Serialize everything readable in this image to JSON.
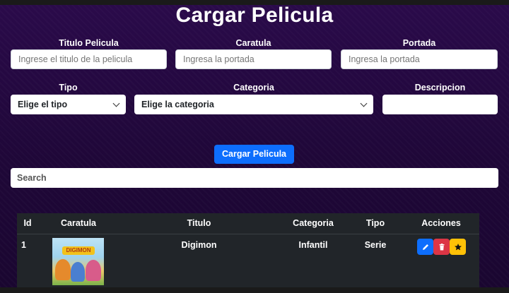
{
  "form": {
    "title": "Cargar Pelicula",
    "titulo_label": "Titulo Pelicula",
    "titulo_placeholder": "Ingrese el titulo de la pelicula",
    "caratula_label": "Caratula",
    "caratula_placeholder": "Ingresa la portada",
    "portada_label": "Portada",
    "portada_placeholder": "Ingresa la portada",
    "tipo_label": "Tipo",
    "tipo_selected": "Elige el tipo",
    "categoria_label": "Categoria",
    "categoria_selected": "Elige la categoria",
    "descripcion_label": "Descripcion",
    "descripcion_value": "",
    "submit_label": "Cargar Pelicula"
  },
  "search": {
    "placeholder": "Search"
  },
  "table": {
    "headers": {
      "id": "Id",
      "caratula": "Caratula",
      "titulo": "Titulo",
      "categoria": "Categoria",
      "tipo": "Tipo",
      "acciones": "Acciones"
    },
    "rows": [
      {
        "id": "1",
        "thumb_text": "DIGIMON",
        "titulo": "Digimon",
        "categoria": "Infantil",
        "tipo": "Serie"
      }
    ]
  },
  "colors": {
    "primary": "#0d6efd",
    "danger": "#dc3545",
    "warning": "#ffc107",
    "table_bg": "#212529",
    "page_bg": "#230942"
  },
  "icons": [
    "pencil-icon",
    "trash-icon",
    "star-icon",
    "chevron-down-icon"
  ]
}
